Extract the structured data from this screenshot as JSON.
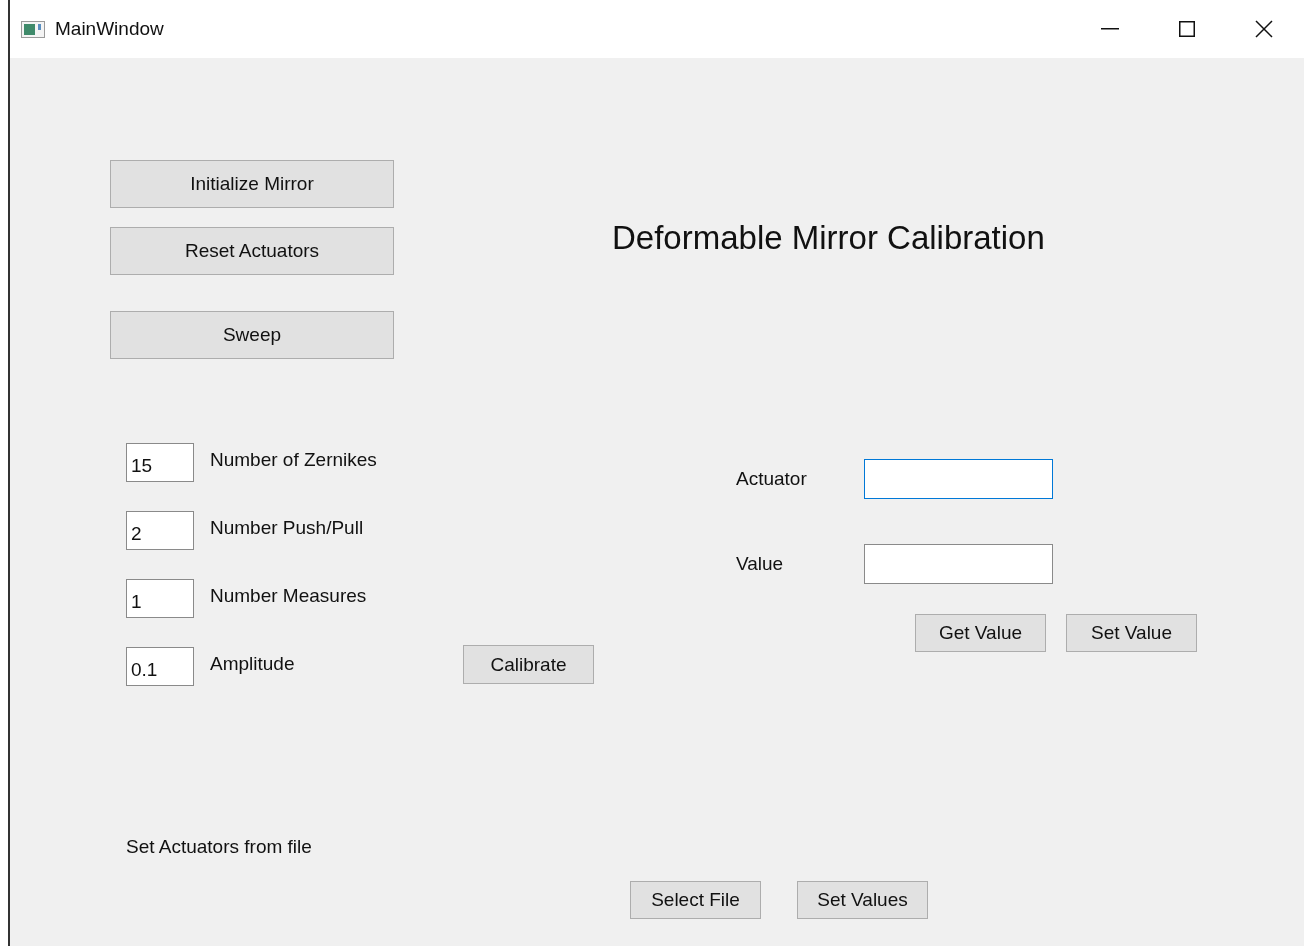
{
  "window": {
    "title": "MainWindow"
  },
  "actions": [
    {
      "label": "Initialize Mirror"
    },
    {
      "label": "Reset Actuators"
    },
    {
      "label": "Sweep"
    }
  ],
  "heading": "Deformable Mirror Calibration",
  "parameters": [
    {
      "value": "15",
      "label": "Number of Zernikes"
    },
    {
      "value": "2",
      "label": "Number Push/Pull"
    },
    {
      "value": "1",
      "label": "Number Measures"
    },
    {
      "value": "0.1",
      "label": "Amplitude"
    }
  ],
  "calibrate_button": "Calibrate",
  "actuator_form": {
    "fields": [
      {
        "label": "Actuator",
        "focused": true
      },
      {
        "label": "Value",
        "focused": false
      }
    ],
    "buttons": [
      "Get Value",
      "Set Value"
    ]
  },
  "file_section": {
    "label": "Set Actuators from file",
    "buttons": [
      "Select File",
      "Set Values"
    ]
  }
}
